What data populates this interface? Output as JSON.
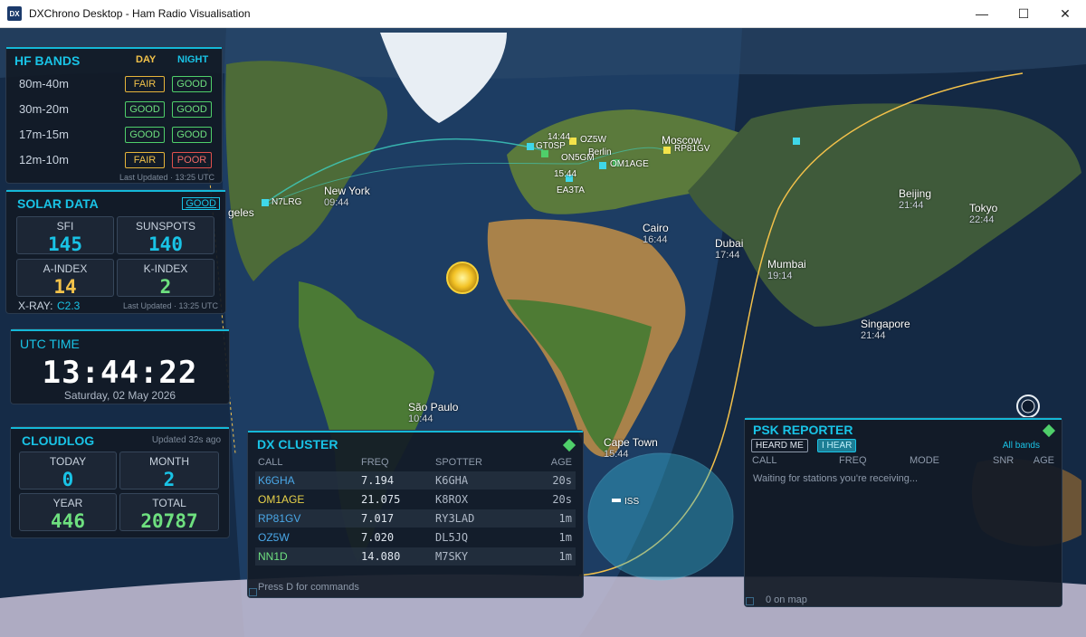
{
  "window": {
    "title": "DXChrono Desktop - Ham Radio Visualisation",
    "icon_text": "DX"
  },
  "hf_bands": {
    "title": "HF BANDS",
    "day_label": "DAY",
    "night_label": "NIGHT",
    "rows": [
      {
        "band": "80m-40m",
        "day": "FAIR",
        "night": "GOOD"
      },
      {
        "band": "30m-20m",
        "day": "GOOD",
        "night": "GOOD"
      },
      {
        "band": "17m-15m",
        "day": "GOOD",
        "night": "GOOD"
      },
      {
        "band": "12m-10m",
        "day": "FAIR",
        "night": "POOR"
      }
    ],
    "updated": "Last Updated · 13:25 UTC"
  },
  "solar": {
    "title": "SOLAR DATA",
    "status": "GOOD",
    "sfi_label": "SFI",
    "sfi": "145",
    "sunspots_label": "SUNSPOTS",
    "sunspots": "140",
    "a_label": "A-INDEX",
    "a": "14",
    "k_label": "K-INDEX",
    "k": "2",
    "xray_label": "X-RAY:",
    "xray": "C2.3",
    "updated": "Last Updated · 13:25 UTC"
  },
  "utc": {
    "title": "UTC TIME",
    "time": "13:44:22",
    "date": "Saturday, 02 May 2026"
  },
  "cloudlog": {
    "title": "CLOUDLOG",
    "updated": "Updated 32s ago",
    "today_label": "TODAY",
    "today": "0",
    "month_label": "MONTH",
    "month": "2",
    "year_label": "YEAR",
    "year": "446",
    "total_label": "TOTAL",
    "total": "20787"
  },
  "dx_cluster": {
    "title": "DX CLUSTER",
    "headers": {
      "call": "CALL",
      "freq": "FREQ",
      "spotter": "SPOTTER",
      "age": "AGE"
    },
    "rows": [
      {
        "call": "K6GHA",
        "freq": "7.194",
        "spotter": "K6GHA",
        "age": "20s",
        "color": "#4aa8e8"
      },
      {
        "call": "OM1AGE",
        "freq": "21.075",
        "spotter": "K8ROX",
        "age": "20s",
        "color": "#e8d24a"
      },
      {
        "call": "RP81GV",
        "freq": "7.017",
        "spotter": "RY3LAD",
        "age": "1m",
        "color": "#4aa8e8"
      },
      {
        "call": "OZ5W",
        "freq": "7.020",
        "spotter": "DL5JQ",
        "age": "1m",
        "color": "#4aa8e8"
      },
      {
        "call": "NN1D",
        "freq": "14.080",
        "spotter": "M7SKY",
        "age": "1m",
        "color": "#6ee07f"
      }
    ],
    "hint": "Press D for commands"
  },
  "psk": {
    "title": "PSK REPORTER",
    "tab_heard_me": "HEARD ME",
    "tab_i_hear": "I HEAR",
    "band_filter": "All bands",
    "headers": {
      "call": "CALL",
      "freq": "FREQ",
      "mode": "MODE",
      "snr": "SNR",
      "age": "AGE"
    },
    "waiting": "Waiting for stations you're receiving...",
    "on_map": "0 on map"
  },
  "map_labels": {
    "new_york": "New York",
    "new_york_t": "09:44",
    "los_angeles": "geles",
    "n7lrg": "N7LRG",
    "sao_paulo": "São Paulo",
    "sao_paulo_t": "10:44",
    "cairo": "Cairo",
    "cairo_t": "16:44",
    "dubai": "Dubai",
    "dubai_t": "17:44",
    "mumbai": "Mumbai",
    "mumbai_t": "19:14",
    "singapore": "Singapore",
    "singapore_t": "21:44",
    "beijing": "Beijing",
    "beijing_t": "21:44",
    "tokyo": "Tokyo",
    "tokyo_t": "22:44",
    "moscow": "Moscow",
    "rp81gv": "RP81GV",
    "cape_town": "Cape Town",
    "cape_town_t": "15:44",
    "oz5w": "OZ5W",
    "om1age": "OM1AGE",
    "ea3ta": "EA3TA",
    "london_t": "14:44",
    "berlin": "Berlin",
    "paris_t": "15:44",
    "gt0sp": "GT0SP",
    "on5gm": "ON5GM",
    "iss": "ISS"
  }
}
